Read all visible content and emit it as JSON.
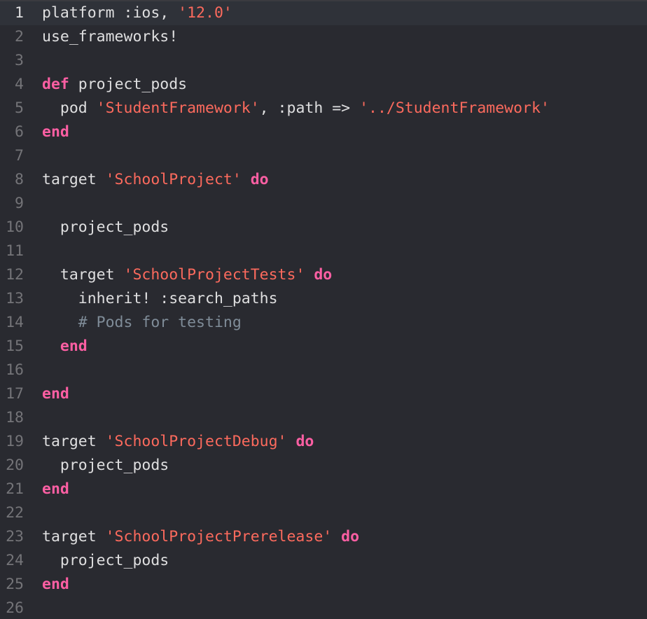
{
  "editor": {
    "current_line": 1,
    "colors": {
      "background": "#292a30",
      "current_line_background": "#2f3239",
      "plain": "#dfdfe0",
      "keyword": "#fc5fa3",
      "string": "#fc6a5d",
      "comment": "#7f8c98",
      "line_number": "#747478"
    },
    "lines": [
      {
        "number": "1",
        "tokens": [
          {
            "type": "plain",
            "text": "platform :ios, "
          },
          {
            "type": "string",
            "text": "'12.0'"
          }
        ]
      },
      {
        "number": "2",
        "tokens": [
          {
            "type": "plain",
            "text": "use_frameworks!"
          }
        ]
      },
      {
        "number": "3",
        "tokens": []
      },
      {
        "number": "4",
        "tokens": [
          {
            "type": "keyword",
            "text": "def"
          },
          {
            "type": "plain",
            "text": " project_pods"
          }
        ]
      },
      {
        "number": "5",
        "tokens": [
          {
            "type": "plain",
            "text": "  pod "
          },
          {
            "type": "string",
            "text": "'StudentFramework'"
          },
          {
            "type": "plain",
            "text": ", :path => "
          },
          {
            "type": "string",
            "text": "'../StudentFramework'"
          }
        ]
      },
      {
        "number": "6",
        "tokens": [
          {
            "type": "keyword",
            "text": "end"
          }
        ]
      },
      {
        "number": "7",
        "tokens": []
      },
      {
        "number": "8",
        "tokens": [
          {
            "type": "plain",
            "text": "target "
          },
          {
            "type": "string",
            "text": "'SchoolProject'"
          },
          {
            "type": "plain",
            "text": " "
          },
          {
            "type": "keyword",
            "text": "do"
          }
        ]
      },
      {
        "number": "9",
        "tokens": []
      },
      {
        "number": "10",
        "tokens": [
          {
            "type": "plain",
            "text": "  project_pods"
          }
        ]
      },
      {
        "number": "11",
        "tokens": []
      },
      {
        "number": "12",
        "tokens": [
          {
            "type": "plain",
            "text": "  target "
          },
          {
            "type": "string",
            "text": "'SchoolProjectTests'"
          },
          {
            "type": "plain",
            "text": " "
          },
          {
            "type": "keyword",
            "text": "do"
          }
        ]
      },
      {
        "number": "13",
        "tokens": [
          {
            "type": "plain",
            "text": "    inherit! :search_paths"
          }
        ]
      },
      {
        "number": "14",
        "tokens": [
          {
            "type": "comment",
            "text": "    # Pods for testing"
          }
        ]
      },
      {
        "number": "15",
        "tokens": [
          {
            "type": "plain",
            "text": "  "
          },
          {
            "type": "keyword",
            "text": "end"
          }
        ]
      },
      {
        "number": "16",
        "tokens": []
      },
      {
        "number": "17",
        "tokens": [
          {
            "type": "keyword",
            "text": "end"
          }
        ]
      },
      {
        "number": "18",
        "tokens": []
      },
      {
        "number": "19",
        "tokens": [
          {
            "type": "plain",
            "text": "target "
          },
          {
            "type": "string",
            "text": "'SchoolProjectDebug'"
          },
          {
            "type": "plain",
            "text": " "
          },
          {
            "type": "keyword",
            "text": "do"
          }
        ]
      },
      {
        "number": "20",
        "tokens": [
          {
            "type": "plain",
            "text": "  project_pods"
          }
        ]
      },
      {
        "number": "21",
        "tokens": [
          {
            "type": "keyword",
            "text": "end"
          }
        ]
      },
      {
        "number": "22",
        "tokens": []
      },
      {
        "number": "23",
        "tokens": [
          {
            "type": "plain",
            "text": "target "
          },
          {
            "type": "string",
            "text": "'SchoolProjectPrerelease'"
          },
          {
            "type": "plain",
            "text": " "
          },
          {
            "type": "keyword",
            "text": "do"
          }
        ]
      },
      {
        "number": "24",
        "tokens": [
          {
            "type": "plain",
            "text": "  project_pods"
          }
        ]
      },
      {
        "number": "25",
        "tokens": [
          {
            "type": "keyword",
            "text": "end"
          }
        ]
      },
      {
        "number": "26",
        "tokens": []
      }
    ]
  }
}
